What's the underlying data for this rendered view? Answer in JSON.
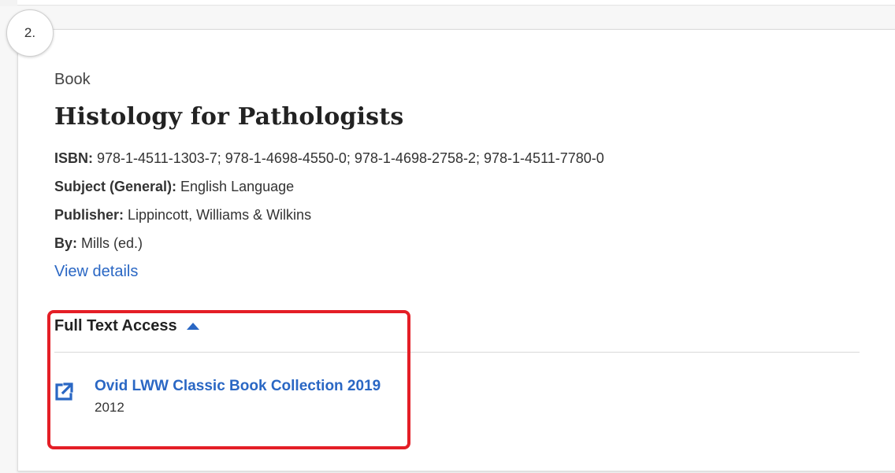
{
  "result": {
    "index": "2.",
    "type": "Book",
    "title": "Histology for Pathologists",
    "isbn_label": "ISBN:",
    "isbn_value": " 978-1-4511-1303-7; 978-1-4698-4550-0; 978-1-4698-2758-2; 978-1-4511-7780-0",
    "subject_label": "Subject (General):",
    "subject_value": " English Language",
    "publisher_label": "Publisher:",
    "publisher_value": " Lippincott, Williams & Wilkins",
    "by_label": "By:",
    "by_value": " Mills (ed.)",
    "view_details": "View details"
  },
  "full_text_access": {
    "heading": "Full Text Access",
    "expanded_icon": "caret-up-icon",
    "sources": [
      {
        "name": "Ovid LWW Classic Book Collection 2019",
        "year": "2012",
        "icon": "external-link-icon"
      }
    ]
  },
  "colors": {
    "link": "#2a67c4",
    "highlight": "#e41e26"
  }
}
